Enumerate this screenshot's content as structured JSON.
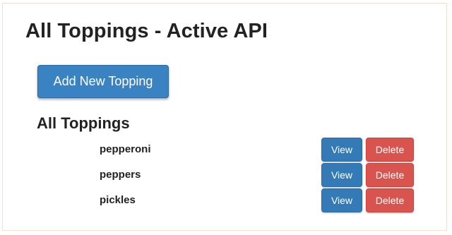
{
  "page": {
    "title": "All Toppings - Active API"
  },
  "toolbar": {
    "add_label": "Add New Topping"
  },
  "list": {
    "heading": "All Toppings",
    "view_label": "View",
    "delete_label": "Delete",
    "items": [
      {
        "name": "pepperoni"
      },
      {
        "name": "peppers"
      },
      {
        "name": "pickles"
      }
    ]
  },
  "colors": {
    "primary": "#337ab7",
    "danger": "#d9534f",
    "text": "#222222",
    "frame_border": "#f1dfd0"
  }
}
